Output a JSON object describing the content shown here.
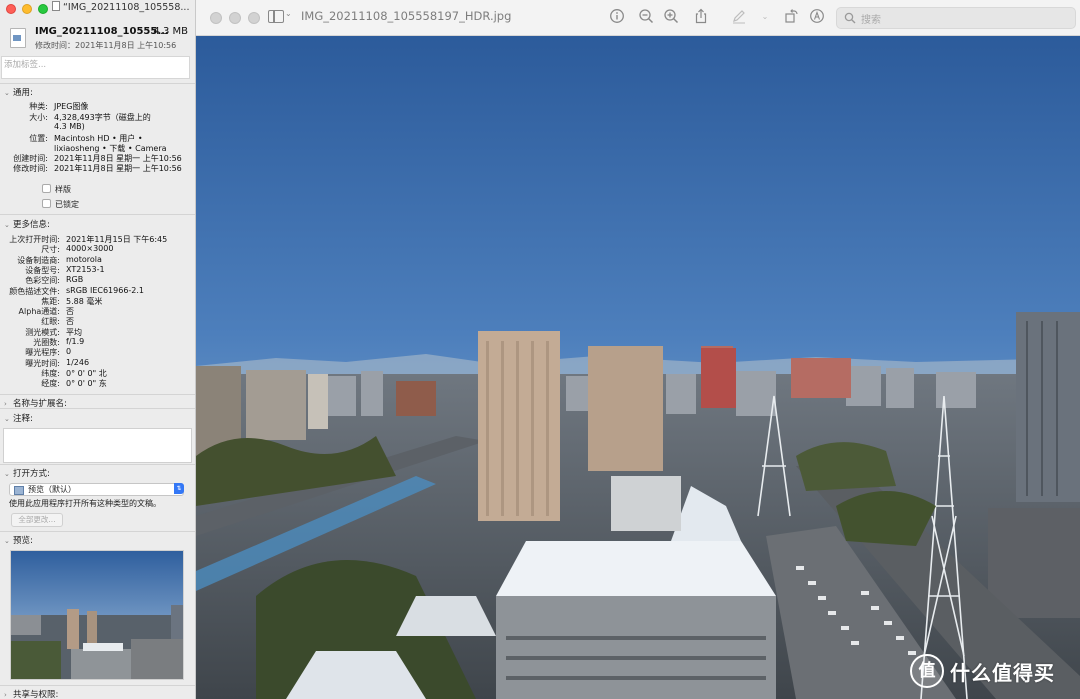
{
  "info_window": {
    "title": "“IMG_20211108_105558...",
    "file_name": "IMG_20211108_10555...",
    "file_size": "4.3 MB",
    "modified_line": "修改时间：2021年11月8日 上午10:56",
    "tags_placeholder": "添加标签...",
    "general": {
      "header": "通用:",
      "kind_k": "种类:",
      "kind_v": "JPEG图像",
      "size_k": "大小:",
      "size_v1": "4,328,493字节（磁盘上的",
      "size_v2": "4.3 MB)",
      "where_k": "位置:",
      "where_v1": "Macintosh HD • 用户 •",
      "where_v2": "lixiaosheng • 下载 • Camera",
      "created_k": "创建时间:",
      "created_v": "2021年11月8日 星期一 上午10:56",
      "modified_k": "修改时间:",
      "modified_v": "2021年11月8日 星期一 上午10:56",
      "stationery": "样版",
      "locked": "已锁定"
    },
    "more_info": {
      "header": "更多信息:",
      "rows": [
        {
          "k": "上次打开时间:",
          "v": "2021年11月15日 下午6:45"
        },
        {
          "k": "尺寸:",
          "v": "4000×3000"
        },
        {
          "k": "设备制造商:",
          "v": "motorola"
        },
        {
          "k": "设备型号:",
          "v": "XT2153-1"
        },
        {
          "k": "色彩空间:",
          "v": "RGB"
        },
        {
          "k": "颜色描述文件:",
          "v": "sRGB IEC61966-2.1"
        },
        {
          "k": "焦距:",
          "v": "5.88 毫米"
        },
        {
          "k": "Alpha通道:",
          "v": "否"
        },
        {
          "k": "红眼:",
          "v": "否"
        },
        {
          "k": "测光模式:",
          "v": "平均"
        },
        {
          "k": "光圈数:",
          "v": "f/1.9"
        },
        {
          "k": "曝光程序:",
          "v": "0"
        },
        {
          "k": "曝光时间:",
          "v": "1/246"
        },
        {
          "k": "纬度:",
          "v": "0° 0' 0\" 北"
        },
        {
          "k": "经度:",
          "v": "0° 0' 0\" 东"
        }
      ]
    },
    "name_ext_header": "名称与扩展名:",
    "comments_header": "注释:",
    "open_with": {
      "header": "打开方式:",
      "app": "预览（默认）",
      "info": "使用此应用程序打开所有这种类型的文稿。",
      "change_all": "全部更改..."
    },
    "preview_header": "预览:",
    "sharing_header": "共享与权限:"
  },
  "preview_window": {
    "title": "IMG_20211108_105558197_HDR.jpg",
    "search_placeholder": "搜索",
    "toolbar_icons": [
      "info-icon",
      "zoom-out-icon",
      "zoom-in-icon",
      "share-icon",
      "markup-icon",
      "rotate-icon",
      "annotate-icon",
      "search-icon"
    ]
  },
  "watermark": {
    "logo": "值",
    "text": "什么值得买"
  }
}
